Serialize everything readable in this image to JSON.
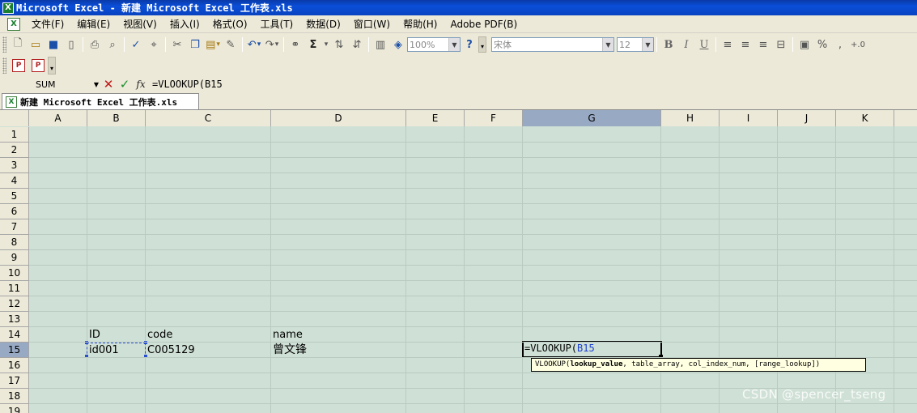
{
  "window": {
    "title": "Microsoft Excel - 新建 Microsoft Excel 工作表.xls",
    "app_icon": "excel-icon"
  },
  "menu": [
    "文件(F)",
    "编辑(E)",
    "视图(V)",
    "插入(I)",
    "格式(O)",
    "工具(T)",
    "数据(D)",
    "窗口(W)",
    "帮助(H)",
    "Adobe PDF(B)"
  ],
  "toolbar": {
    "zoom": "100%",
    "font_name": "宋体",
    "font_size": "12",
    "bold": "B",
    "italic": "I",
    "underline": "U",
    "percent": "%",
    "comma": ",",
    "sigma": "Σ"
  },
  "formula_bar": {
    "name_box": "SUM",
    "cancel": "✕",
    "enter": "✓",
    "fx": "fx",
    "formula": "=VLOOKUP(B15"
  },
  "workbook_tab": {
    "label": "新建 Microsoft Excel 工作表.xls"
  },
  "grid": {
    "columns": [
      "A",
      "B",
      "C",
      "D",
      "E",
      "F",
      "G",
      "H",
      "I",
      "J",
      "K"
    ],
    "rows": [
      "1",
      "2",
      "3",
      "4",
      "5",
      "6",
      "7",
      "8",
      "9",
      "10",
      "11",
      "12",
      "13",
      "14",
      "15",
      "16",
      "17",
      "18",
      "19"
    ],
    "selected_column": "G",
    "selected_row": "15",
    "cells": {
      "B14": "ID",
      "C14": "code",
      "D14": "name",
      "B15": "id001",
      "C15": "C005129",
      "D15": "曾文锋",
      "G15_prefix": "=VLOOKUP(",
      "G15_ref": "B15"
    }
  },
  "tooltip": {
    "func": "VLOOKUP(",
    "arg1": "lookup_value",
    "rest": ", table_array, col_index_num, [range_lookup])"
  },
  "watermark": "CSDN @spencer_tseng",
  "colors": {
    "title_bar": "#0a4ed8",
    "cell_background": "#cfe0d6",
    "selected_header": "#98a9c4",
    "reference_blue": "#1b3fd0"
  }
}
